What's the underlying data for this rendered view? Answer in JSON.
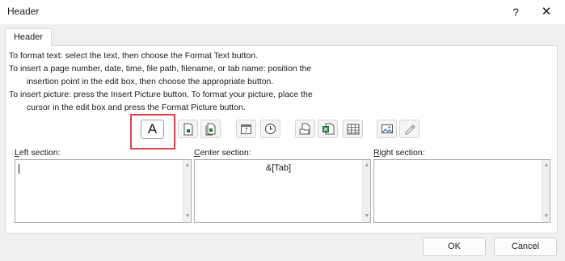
{
  "window": {
    "title": "Header",
    "help_label": "?",
    "close_label": "✕"
  },
  "tab": {
    "label": "Header"
  },
  "instructions": [
    "To format text:  select the text, then choose the Format Text button.",
    "To insert a page number, date, time, file path, filename, or tab name:  position the",
    "insertion point in the edit box, then choose the appropriate button.",
    "To insert picture: press the Insert Picture button.  To format your picture, place the",
    "cursor in the edit box and press the Format Picture button."
  ],
  "toolbar": {
    "format_text_glyph": "A",
    "buttons": [
      "format-text",
      "insert-page-number",
      "insert-number-of-pages",
      "insert-date",
      "insert-time",
      "insert-file-path",
      "insert-file-name",
      "insert-sheet-name",
      "insert-picture",
      "format-picture"
    ]
  },
  "sections": {
    "left": {
      "label_accel": "L",
      "label_rest": "eft section:",
      "value": ""
    },
    "center": {
      "label_accel": "C",
      "label_rest": "enter section:",
      "value": "&[Tab]"
    },
    "right": {
      "label_accel": "R",
      "label_rest": "ight section:",
      "value": ""
    }
  },
  "footer": {
    "ok_label": "OK",
    "cancel_label": "Cancel"
  },
  "colors": {
    "highlight": "#d9434c",
    "excel_green": "#1d7a3e"
  }
}
